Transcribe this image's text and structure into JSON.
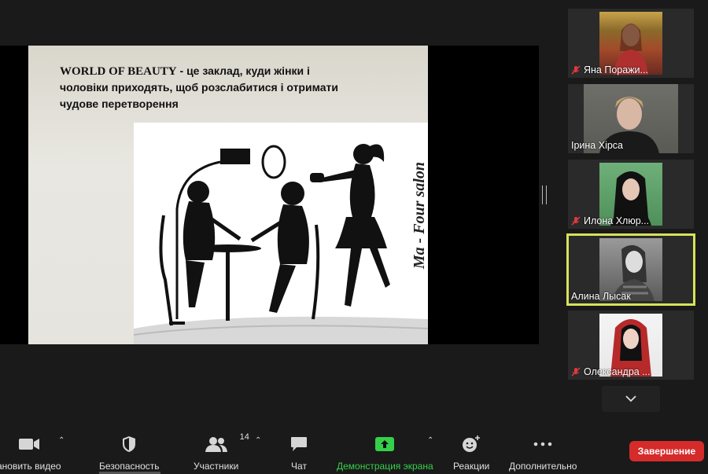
{
  "slide": {
    "title_line1": "WORLD OF BEAUTY",
    "title_line1_rest": " - це заклад, куди жінки і",
    "title_line2": "чоловіки приходять, щоб розслабитися і отримати",
    "title_line3": "чудове перетворення",
    "brand": "Ma - Four salon"
  },
  "participants": [
    {
      "name": "Яна Поражи...",
      "muted": true
    },
    {
      "name": "Ірина Хірса",
      "muted": false
    },
    {
      "name": "Илона Хлюр...",
      "muted": true
    },
    {
      "name": "Алина Лысак",
      "muted": false,
      "active_speaker": true
    },
    {
      "name": "Олександра ...",
      "muted": true
    }
  ],
  "toolbar": {
    "video_label": "ановить видео",
    "security_label": "Безопасность",
    "participants_label": "Участники",
    "participants_count": "14",
    "chat_label": "Чат",
    "share_label": "Демонстрация экрана",
    "reactions_label": "Реакции",
    "more_label": "Дополнительно",
    "end_label": "Завершение"
  },
  "colors": {
    "active_speaker": "#d7e35a",
    "share_green": "#35d04a",
    "end_red": "#d62b2b",
    "muted_red": "#e0393e"
  }
}
